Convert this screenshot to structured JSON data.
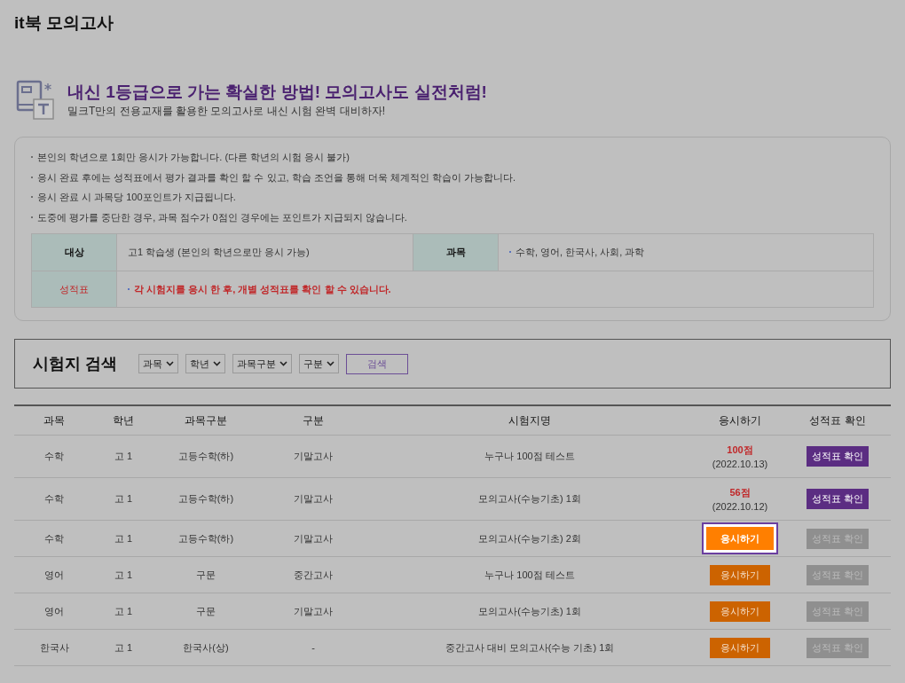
{
  "page_title": "it북 모의고사",
  "banner": {
    "headline": "내신 1등급으로 가는 확실한 방법! 모의고사도 실전처럼!",
    "subline": "밀크T만의 전용교재를 활용한 모의고사로 내신 시험 완벽 대비하자!"
  },
  "notices": [
    "본인의 학년으로 1회만 응시가 가능합니다. (다른 학년의 시험 응시 불가)",
    "응시 완료 후에는 성적표에서 평가 결과를 확인 할 수 있고, 학습 조언을 통해 더욱 체계적인 학습이 가능합니다.",
    "응시 완료 시 과목당 100포인트가 지급됩니다.",
    "도중에 평가를 중단한 경우, 과목 점수가 0점인 경우에는 포인트가 지급되지 않습니다."
  ],
  "info_table": {
    "target_label": "대상",
    "target_value": "고1 학습생 (본인의 학년으로만 응시 가능)",
    "subject_label": "과목",
    "subject_value": "수학, 영어, 한국사, 사회, 과학",
    "report_label": "성적표",
    "report_value": "각 시험지를 응시 한 후, 개별 성적표를 확인 할 수 있습니다."
  },
  "search": {
    "title": "시험지 검색",
    "filters": [
      "과목",
      "학년",
      "과목구분",
      "구분"
    ],
    "button": "검색"
  },
  "table": {
    "columns": [
      "과목",
      "학년",
      "과목구분",
      "구분",
      "시험지명",
      "응시하기",
      "성적표 확인"
    ],
    "rows": [
      {
        "subject": "수학",
        "grade": "고 1",
        "category": "고등수학(하)",
        "type": "기말고사",
        "name": "누구나 100점 테스트",
        "kind": "score",
        "score": "100점",
        "date": "(2022.10.13)",
        "report": "성적표 확인",
        "report_enabled": true
      },
      {
        "subject": "수학",
        "grade": "고 1",
        "category": "고등수학(하)",
        "type": "기말고사",
        "name": "모의고사(수능기초) 1회",
        "kind": "score",
        "score": "56점",
        "date": "(2022.10.12)",
        "report": "성적표 확인",
        "report_enabled": true
      },
      {
        "subject": "수학",
        "grade": "고 1",
        "category": "고등수학(하)",
        "type": "기말고사",
        "name": "모의고사(수능기초) 2회",
        "kind": "take",
        "take": "응시하기",
        "highlighted": true,
        "report": "성적표 확인",
        "report_enabled": false
      },
      {
        "subject": "영어",
        "grade": "고 1",
        "category": "구문",
        "type": "중간고사",
        "name": "누구나 100점 테스트",
        "kind": "take",
        "take": "응시하기",
        "highlighted": false,
        "report": "성적표 확인",
        "report_enabled": false
      },
      {
        "subject": "영어",
        "grade": "고 1",
        "category": "구문",
        "type": "기말고사",
        "name": "모의고사(수능기초) 1회",
        "kind": "take",
        "take": "응시하기",
        "highlighted": false,
        "report": "성적표 확인",
        "report_enabled": false
      },
      {
        "subject": "한국사",
        "grade": "고 1",
        "category": "한국사(상)",
        "type": "-",
        "name": "중간고사 대비 모의고사(수능 기초) 1회",
        "kind": "take",
        "take": "응시하기",
        "highlighted": false,
        "report": "성적표 확인",
        "report_enabled": false
      }
    ]
  }
}
